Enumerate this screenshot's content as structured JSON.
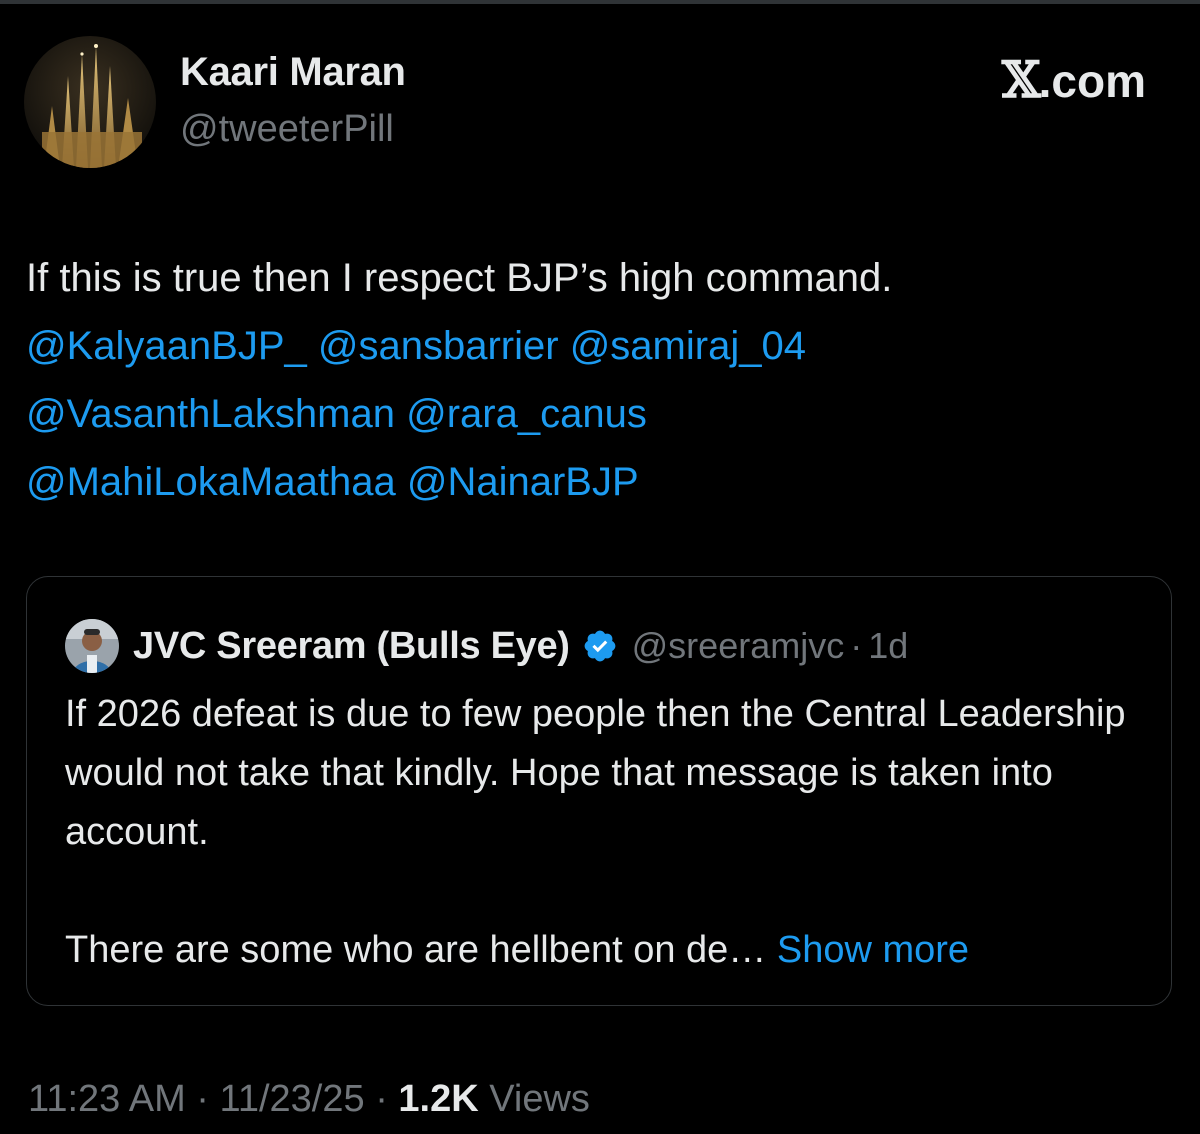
{
  "author": {
    "display_name": "Kaari Maran",
    "handle": "@tweeterPill",
    "avatar_icon": "cathedral-photo-avatar"
  },
  "brand": {
    "label": ".com",
    "logo_icon": "x-logo-icon"
  },
  "tweet": {
    "text_lead": "If this is true then I respect BJP’s high command.",
    "mentions": [
      "@KalyaanBJP_",
      "@sansbarrier",
      "@samiraj_04",
      "@VasanthLakshman",
      "@rara_canus",
      "@MahiLokaMaathaa",
      "@NainarBJP"
    ]
  },
  "quote": {
    "display_name": "JVC Sreeram (Bulls Eye)",
    "verified_icon": "verified-badge-icon",
    "handle": "@sreeramjvc",
    "separator": "·",
    "age": "1d",
    "paragraph_1": "If 2026 defeat is due to few people then the Central Leadership would not take that kindly. Hope that message is taken into account.",
    "paragraph_2": "There are some who are hellbent on de…",
    "show_more": "Show more"
  },
  "meta": {
    "time": "11:23 AM",
    "sep1": "·",
    "date": "11/23/25",
    "sep2": "·",
    "views_count": "1.2K",
    "views_label": "Views"
  },
  "colors": {
    "background": "#000000",
    "text": "#e7e9ea",
    "secondary": "#71767b",
    "link": "#1d9bf0",
    "border": "#2f3336"
  }
}
